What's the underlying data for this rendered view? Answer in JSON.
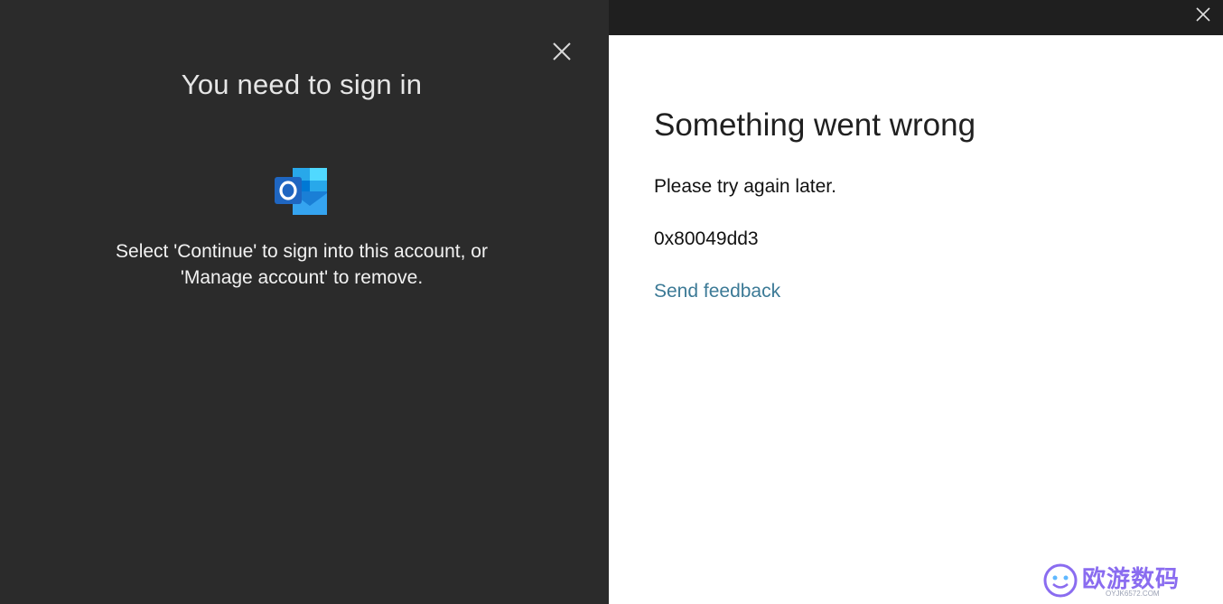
{
  "left_dialog": {
    "title": "You need to sign in",
    "message_line1": "Select 'Continue' to sign into this account, or",
    "message_line2": "'Manage account' to remove.",
    "icon": "outlook-icon",
    "close_icon": "close-icon"
  },
  "right_dialog": {
    "close_icon": "close-icon",
    "heading": "Something went wrong",
    "message": "Please try again later.",
    "error_code": "0x80049dd3",
    "feedback_link": "Send feedback",
    "link_color": "#3c7a96"
  },
  "watermark": {
    "text": "欧游数码",
    "subtext": "OYJK6572.COM"
  },
  "colors": {
    "left_bg": "#2b2b2b",
    "right_titlebar_bg": "#1f1f1f",
    "right_bg": "#ffffff",
    "outlook_blue": "#1f66c1"
  }
}
